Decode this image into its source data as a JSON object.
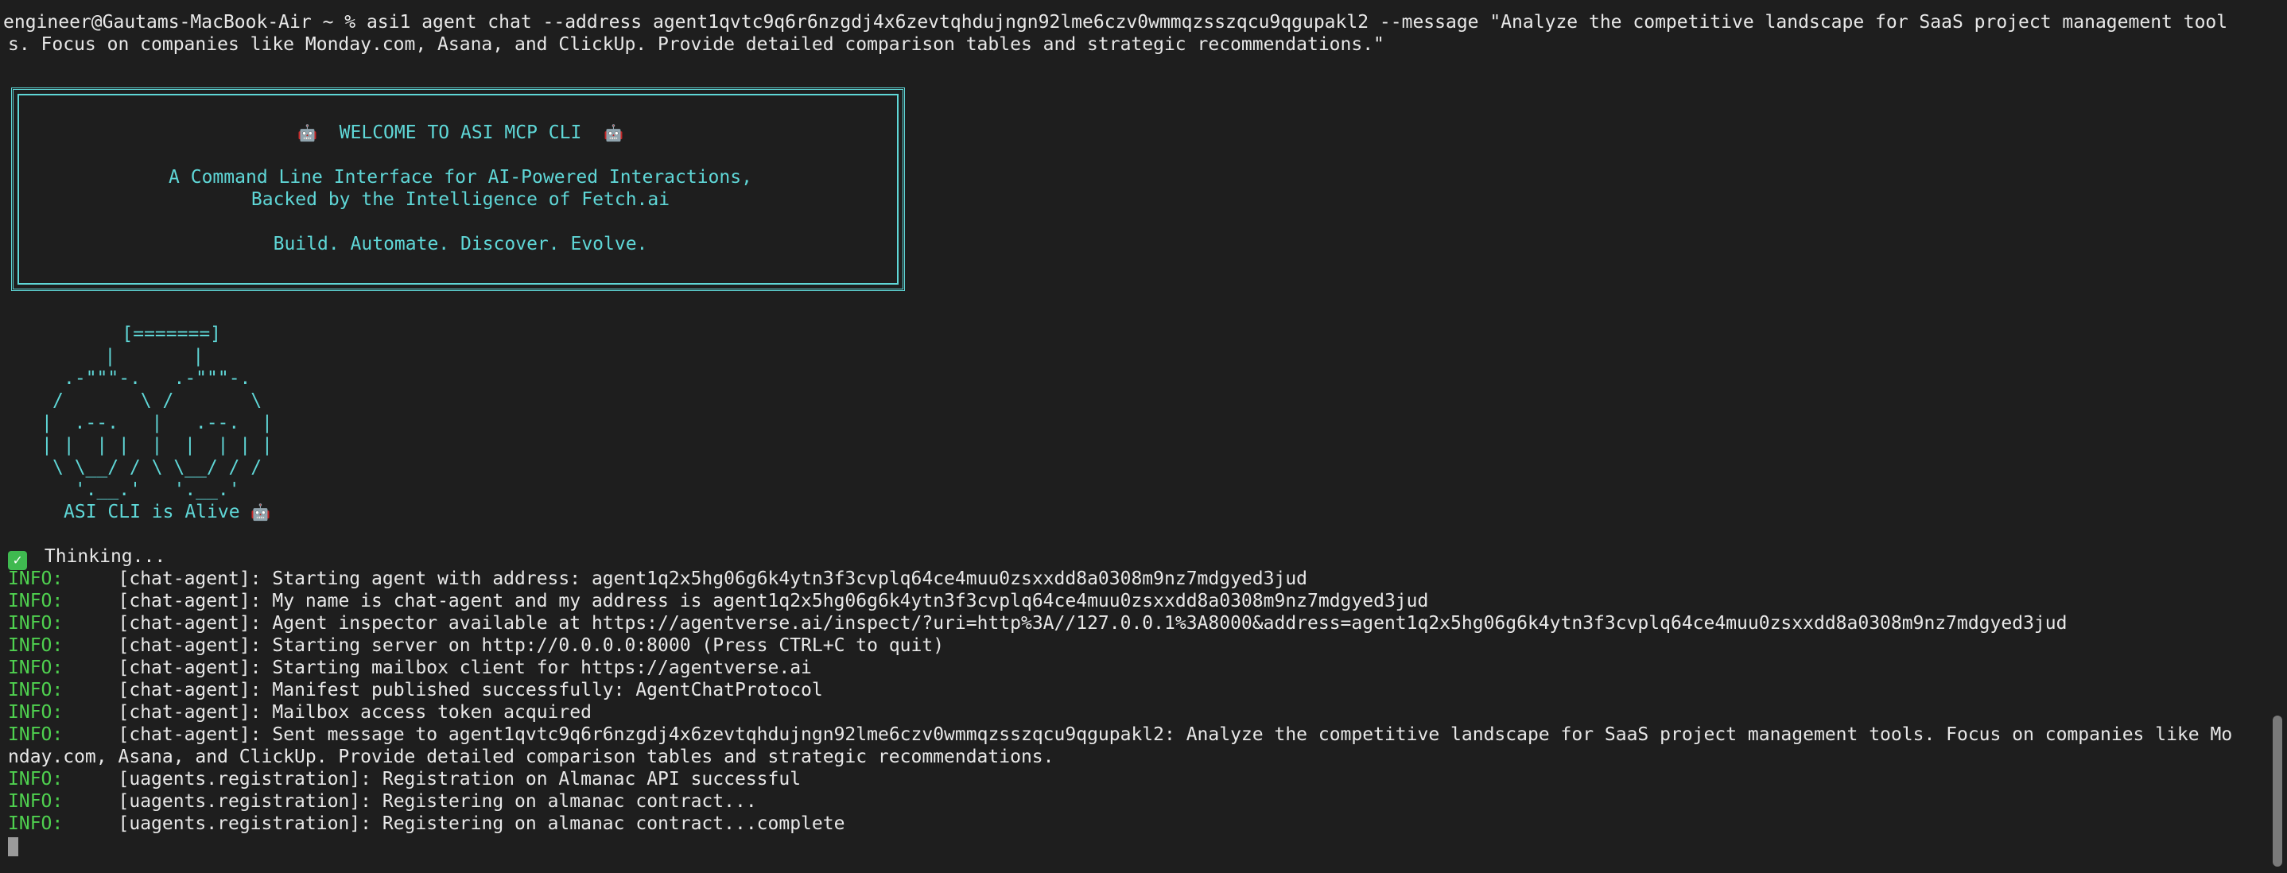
{
  "terminal": {
    "prompt_line_1": "engineer@Gautams-MacBook-Air ~ % asi1 agent chat --address agent1qvtc9q6r6nzgdj4x6zevtqhdujngn92lme6czv0wmmqzsszqcu9qgupakl2 --message \"Analyze the competitive landscape for SaaS project management tool",
    "prompt_line_2": "s. Focus on companies like Monday.com, Asana, and ClickUp. Provide detailed comparison tables and strategic recommendations.\"",
    "banner": {
      "title": "WELCOME TO ASI MCP CLI",
      "subtitle_1": "A Command Line Interface for AI-Powered Interactions,",
      "subtitle_2": "Backed by the Intelligence of Fetch.ai",
      "tagline": "Build. Automate. Discover. Evolve."
    },
    "ascii_art": {
      "line_1": "    [=======]",
      "line_2": "   |       |",
      "line_3": ".-\"\"\"-.   .-\"\"\"-.",
      "line_4": "/       \\ /       \\",
      "line_5": "|  .--.   |   .--.  |",
      "line_6": "| |  | |  |  |  | | |",
      "line_7": "\\ \\__/ / \\ \\__/ / /",
      "line_8": " '.__.'   '.__.'",
      "alive_text": "ASI CLI is Alive"
    },
    "thinking_text": "Thinking...",
    "info_label": "INFO:",
    "logs": [
      {
        "source": "[chat-agent]:",
        "message": "Starting agent with address: agent1q2x5hg06g6k4ytn3f3cvplq64ce4muu0zsxxdd8a0308m9nz7mdgyed3jud"
      },
      {
        "source": "[chat-agent]:",
        "message": "My name is chat-agent and my address is agent1q2x5hg06g6k4ytn3f3cvplq64ce4muu0zsxxdd8a0308m9nz7mdgyed3jud"
      },
      {
        "source": "[chat-agent]:",
        "message": "Agent inspector available at https://agentverse.ai/inspect/?uri=http%3A//127.0.0.1%3A8000&address=agent1q2x5hg06g6k4ytn3f3cvplq64ce4muu0zsxxdd8a0308m9nz7mdgyed3jud"
      },
      {
        "source": "[chat-agent]:",
        "message": "Starting server on http://0.0.0.0:8000 (Press CTRL+C to quit)"
      },
      {
        "source": "[chat-agent]:",
        "message": "Starting mailbox client for https://agentverse.ai"
      },
      {
        "source": "[chat-agent]:",
        "message": "Manifest published successfully: AgentChatProtocol"
      },
      {
        "source": "[chat-agent]:",
        "message": "Mailbox access token acquired"
      },
      {
        "source": "[chat-agent]:",
        "message": "Sent message to agent1qvtc9q6r6nzgdj4x6zevtqhdujngn92lme6czv0wmmqzsszqcu9qgupakl2: Analyze the competitive landscape for SaaS project management tools. Focus on companies like Mo"
      }
    ],
    "log_wrap_line": "nday.com, Asana, and ClickUp. Provide detailed comparison tables and strategic recommendations.",
    "registration_logs": [
      {
        "source": "[uagents.registration]:",
        "message": "Registration on Almanac API successful"
      },
      {
        "source": "[uagents.registration]:",
        "message": "Registering on almanac contract..."
      },
      {
        "source": "[uagents.registration]:",
        "message": "Registering on almanac contract...complete"
      }
    ],
    "colors": {
      "background": "#1e1e1e",
      "accent_cyan": "#5fd7d7",
      "info_green": "#4fd14f",
      "text": "#e8e8e8"
    }
  }
}
